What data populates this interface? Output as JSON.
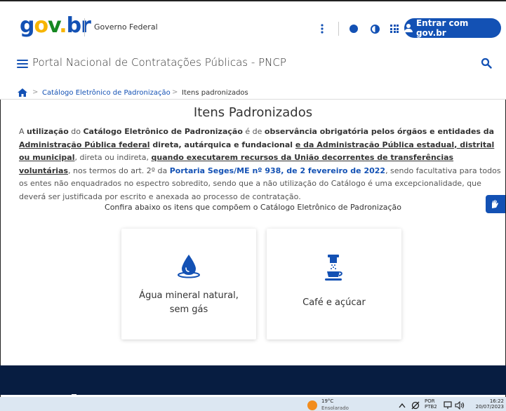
{
  "header": {
    "logo": {
      "g": "g",
      "o": "o",
      "v": "v",
      "dot": ".",
      "br": "br"
    },
    "gov_label": "Governo Federal",
    "login_label": "Entrar com gov.br"
  },
  "nav": {
    "portal_title": "Portal Nacional de Contratações Públicas - PNCP"
  },
  "breadcrumb": {
    "sep": ">",
    "items": [
      {
        "label": "Catálogo Eletrônico de Padronização"
      },
      {
        "label": "Itens padronizados"
      }
    ]
  },
  "main": {
    "title": "Itens Padronizados",
    "intro": {
      "p1": "A ",
      "b1": "utilização",
      "p2": " do ",
      "b2": "Catálogo Eletrônico de Padronização",
      "p3": " é de ",
      "b3": "observância obrigatória pelos órgãos e entidades da",
      "p4": " ",
      "u1": "Administração Pública federal",
      "b4": " direta, autárquica e fundacional ",
      "u2": "e da Administração Pública estadual, distrital ou municipal",
      "p5": ", direta ou indireta, ",
      "u3": "quando executarem recursos da União decorrentes de transferências voluntárias",
      "p6": ", nos termos do art. 2º da ",
      "link": "Portaria Seges/ME nº 938, de 2 fevereiro de 2022",
      "p7": ", sendo facultativa para todos os entes não enquadrados no espectro sobredito, sendo que a não utilização do Catálogo é uma excepcionalidade, que deverá ser justificada por escrito e anexada ao processo de contratação."
    },
    "confira": "Confira abaixo os itens que compõem o Catálogo Eletrônico de Padronização",
    "cards": [
      {
        "label_line1": "Água mineral natural,",
        "label_line2": "sem gás",
        "icon": "water-drop-icon"
      },
      {
        "label": "Café e açúcar",
        "icon": "coffee-cup-icon"
      }
    ]
  },
  "taskbar": {
    "temp": "19°C",
    "weather": "Ensolarado",
    "lang_line1": "POR",
    "lang_line2": "PTB2",
    "time": "16:22",
    "date": "20/07/2023"
  },
  "colors": {
    "primary": "#1351b4",
    "footer": "#071d41",
    "taskbar": "#dce7f2"
  }
}
